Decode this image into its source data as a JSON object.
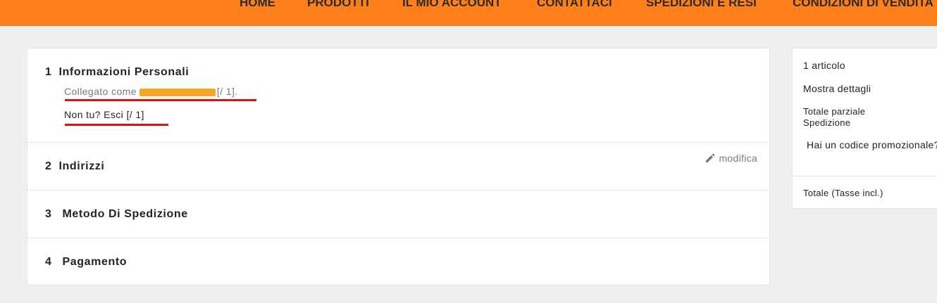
{
  "nav": {
    "items": [
      "HOME",
      "PRODOTTI",
      "IL MIO ACCOUNT",
      "CONTATTACI",
      "SPEDIZIONI E RESI",
      "CONDIZIONI DI VENDITA"
    ]
  },
  "checkout": {
    "step1": {
      "number": "1",
      "title": "Informazioni Personali",
      "logged_in_prefix": "Collegato come",
      "logged_in_suffix": "[/ 1].",
      "not_you": "Non tu? Esci [/ 1]"
    },
    "step2": {
      "number": "2",
      "title": "Indirizzi",
      "edit_label": "modifica"
    },
    "step3": {
      "number": "3",
      "title": "Metodo Di Spedizione"
    },
    "step4": {
      "number": "4",
      "title": "Pagamento"
    }
  },
  "summary": {
    "items_count": "1 articolo",
    "show_details": "Mostra dettagli",
    "subtotal_label": "Totale parziale",
    "shipping_label": "Spedizione",
    "promo_label": "Hai un codice promozionale?",
    "total_label": "Totale (Tasse incl.)"
  },
  "colors": {
    "header_bg": "#ff7f1a",
    "redaction": "#f5a623",
    "underline": "#e01010"
  },
  "icons": {
    "edit": "pencil-icon"
  }
}
